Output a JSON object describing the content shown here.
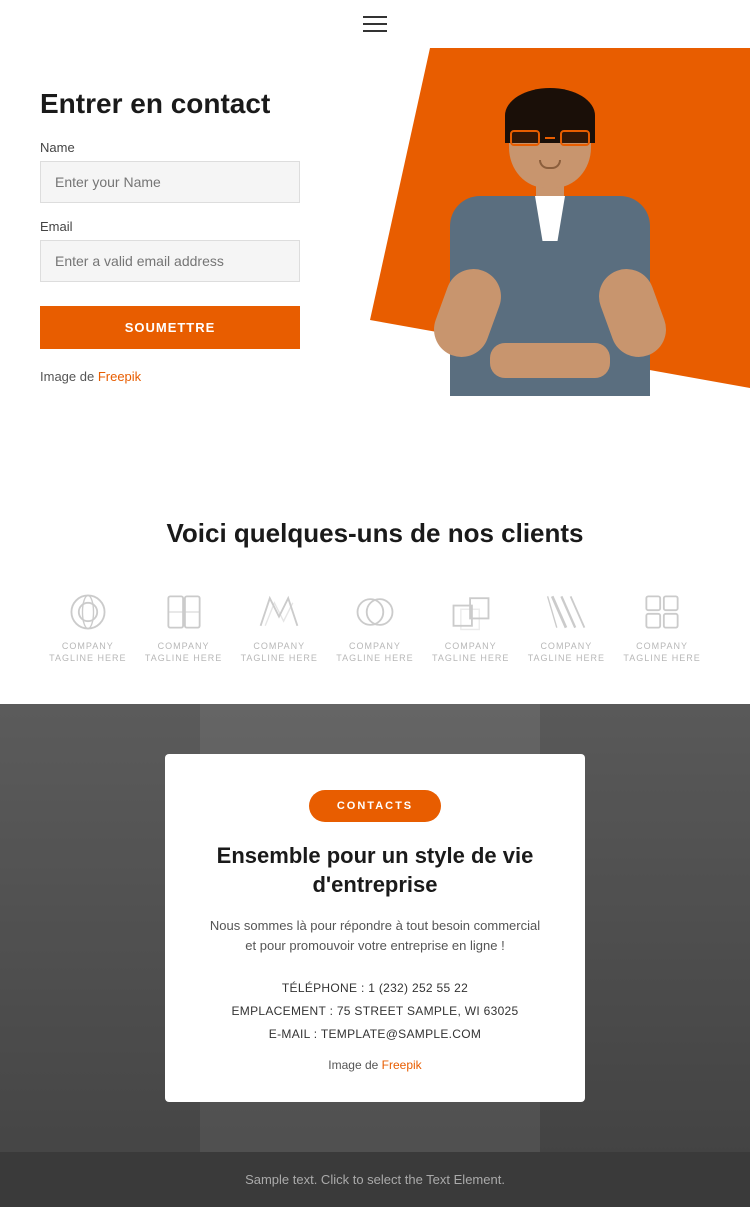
{
  "header": {
    "menu_icon": "hamburger-icon"
  },
  "contact": {
    "title": "Entrer en contact",
    "name_label": "Name",
    "name_placeholder": "Enter your Name",
    "email_label": "Email",
    "email_placeholder": "Enter a valid email address",
    "submit_label": "SOUMETTRE",
    "image_credit_text": "Image de ",
    "image_credit_link": "Freepik"
  },
  "clients": {
    "title": "Voici quelques-uns de nos clients",
    "logos": [
      {
        "id": 1,
        "line1": "COMPANY",
        "line2": "TAGLINE HERE"
      },
      {
        "id": 2,
        "line1": "COMPANY",
        "line2": "TAGLINE HERE"
      },
      {
        "id": 3,
        "line1": "COMPANY",
        "line2": "TAGLINE HERE"
      },
      {
        "id": 4,
        "line1": "COMPANY",
        "line2": "TAGLINE HERE"
      },
      {
        "id": 5,
        "line1": "COMPANY",
        "line2": "TAGLINE HERE"
      },
      {
        "id": 6,
        "line1": "COMPANY",
        "line2": "TAGLINE HERE"
      },
      {
        "id": 7,
        "line1": "COMPANY",
        "line2": "TAGLINE HERE"
      }
    ]
  },
  "cta": {
    "badge": "CONTACTS",
    "headline": "Ensemble pour un style de vie d'entreprise",
    "description": "Nous sommes là pour répondre à tout besoin commercial et pour promouvoir votre entreprise en ligne !",
    "phone": "TÉLÉPHONE : 1 (232) 252 55 22",
    "location": "EMPLACEMENT : 75 STREET SAMPLE, WI 63025",
    "email": "E-MAIL : TEMPLATE@SAMPLE.COM",
    "image_credit_text": "Image de ",
    "image_credit_link": "Freepik"
  },
  "footer": {
    "text": "Sample text. Click to select the Text Element."
  }
}
